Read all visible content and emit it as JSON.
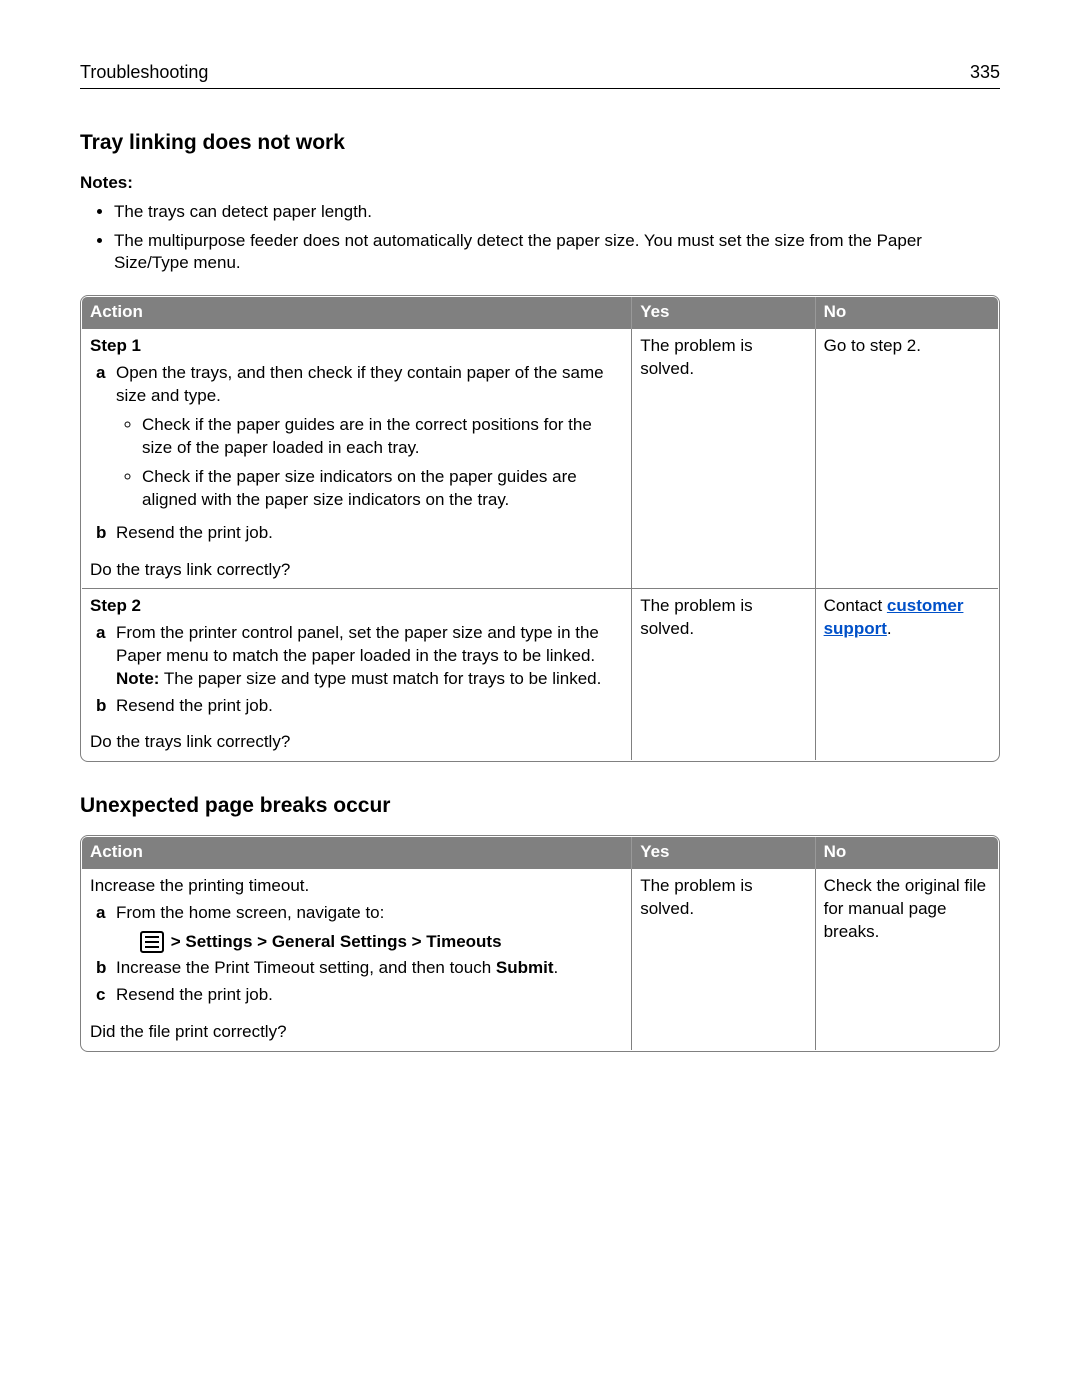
{
  "header": {
    "section": "Troubleshooting",
    "page": "335"
  },
  "sec1": {
    "heading": "Tray linking does not work",
    "notes_label": "Notes:",
    "notes": [
      "The trays can detect paper length.",
      "The multipurpose feeder does not automatically detect the paper size. You must set the size from the Paper Size/Type menu."
    ],
    "table": {
      "head": {
        "action": "Action",
        "yes": "Yes",
        "no": "No"
      },
      "rows": [
        {
          "step": "Step 1",
          "a": "Open the trays, and then check if they contain paper of the same size and type.",
          "bullets": [
            "Check if the paper guides are in the correct positions for the size of the paper loaded in each tray.",
            "Check if the paper size indicators on the paper guides are aligned with the paper size indicators on the tray."
          ],
          "b": "Resend the print job.",
          "question": "Do the trays link correctly?",
          "yes": "The problem is solved.",
          "no": "Go to step 2."
        },
        {
          "step": "Step 2",
          "a": "From the printer control panel, set the paper size and type in the Paper menu to match the paper loaded in the trays to be linked.",
          "note_label": "Note:",
          "note": " The paper size and type must match for trays to be linked.",
          "b": "Resend the print job.",
          "question": "Do the trays link correctly?",
          "yes": "The problem is solved.",
          "no_pre": "Contact ",
          "no_link": "customer support",
          "no_post": "."
        }
      ]
    }
  },
  "sec2": {
    "heading": "Unexpected page breaks occur",
    "table": {
      "head": {
        "action": "Action",
        "yes": "Yes",
        "no": "No"
      },
      "row": {
        "intro": "Increase the printing timeout.",
        "a": "From the home screen, navigate to:",
        "path": " > Settings > General Settings > Timeouts",
        "b_pre": "Increase the Print Timeout setting, and then touch ",
        "b_bold": "Submit",
        "b_post": ".",
        "c": "Resend the print job.",
        "question": "Did the file print correctly?",
        "yes": "The problem is solved.",
        "no": "Check the original file for manual page breaks."
      }
    }
  }
}
